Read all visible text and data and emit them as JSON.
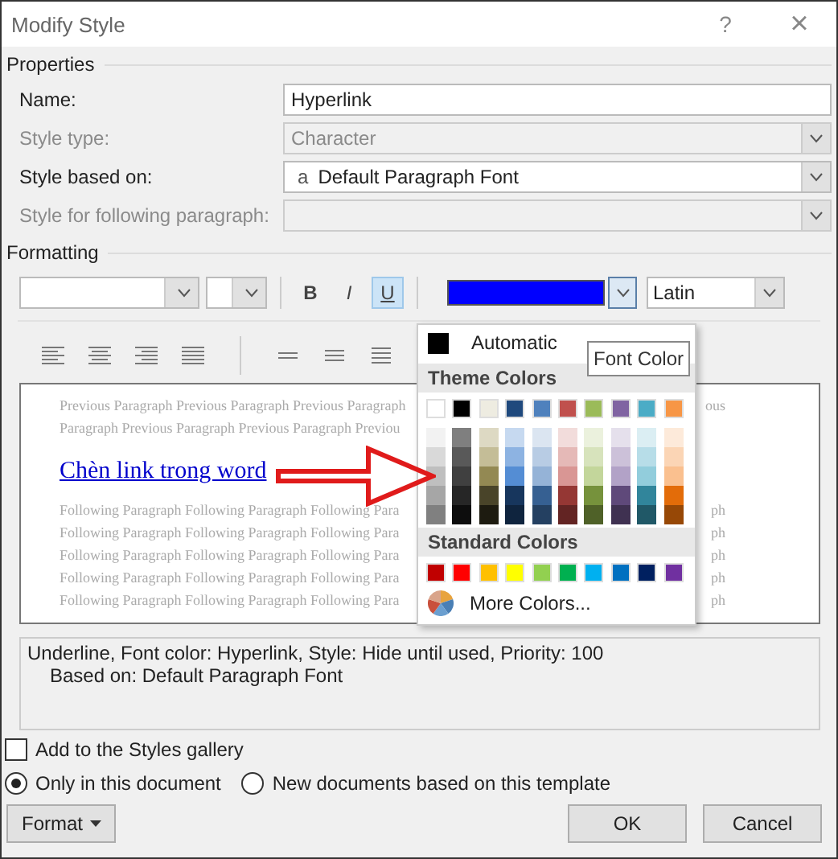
{
  "window": {
    "title": "Modify Style",
    "help": "?",
    "close": "×"
  },
  "properties": {
    "heading": "Properties",
    "fields": [
      {
        "label": "Name:",
        "value": "Hyperlink",
        "kind": "text",
        "disabled": false
      },
      {
        "label": "Style type:",
        "value": "Character",
        "kind": "dropdown",
        "disabled": true
      },
      {
        "label": "Style based on:",
        "value": "Default Paragraph Font",
        "glyph": "a",
        "kind": "dropdown",
        "disabled": false
      },
      {
        "label": "Style for following paragraph:",
        "kind": "dropdown",
        "disabled": true
      }
    ]
  },
  "formatting": {
    "heading": "Formatting",
    "styles": [
      {
        "label": "B",
        "selected": false
      },
      {
        "label": "I",
        "selected": false
      },
      {
        "label": "U",
        "selected": true
      }
    ],
    "font_color": {
      "color": "#0000ff"
    },
    "script": {
      "value": "Latin"
    }
  },
  "preview": {
    "previous": [
      {
        "left": "Previous Paragraph Previous Paragraph Previous Paragraph",
        "right": "ous"
      },
      {
        "left": "Paragraph Previous Paragraph Previous Paragraph Previou"
      }
    ],
    "sample": "Chèn link trong word",
    "following": [
      {
        "left": "Following Paragraph Following Paragraph Following Para",
        "right": "ph"
      },
      {
        "left": "Following Paragraph Following Paragraph Following Para",
        "right": "ph"
      },
      {
        "left": "Following Paragraph Following Paragraph Following Para",
        "right": "ph"
      },
      {
        "left": "Following Paragraph Following Paragraph Following Para",
        "right": "ph"
      },
      {
        "left": "Following Paragraph Following Paragraph Following Para",
        "right": "ph"
      }
    ]
  },
  "color_menu": {
    "automatic": "Automatic",
    "tooltip": "Font Color",
    "theme_heading": "Theme Colors",
    "theme": [
      {
        "color": "#ffffff"
      },
      {
        "color": "#000000"
      },
      {
        "color": "#eeece1"
      },
      {
        "color": "#1f497d"
      },
      {
        "color": "#4f81bd"
      },
      {
        "color": "#c0504d"
      },
      {
        "color": "#9bbb59"
      },
      {
        "color": "#8064a2"
      },
      {
        "color": "#4bacc6"
      },
      {
        "color": "#f79646"
      }
    ],
    "shades": [
      [
        {
          "color": "#f2f2f2"
        },
        {
          "color": "#d9d9d9"
        },
        {
          "color": "#bfbfbf"
        },
        {
          "color": "#a6a6a6"
        },
        {
          "color": "#808080"
        }
      ],
      [
        {
          "color": "#7f7f7f"
        },
        {
          "color": "#595959"
        },
        {
          "color": "#404040"
        },
        {
          "color": "#262626"
        },
        {
          "color": "#0d0d0d"
        }
      ],
      [
        {
          "color": "#ddd9c3"
        },
        {
          "color": "#c4bd97"
        },
        {
          "color": "#938953"
        },
        {
          "color": "#494429"
        },
        {
          "color": "#1d1b10"
        }
      ],
      [
        {
          "color": "#c6d9f0"
        },
        {
          "color": "#8db3e2"
        },
        {
          "color": "#548dd4"
        },
        {
          "color": "#17365d"
        },
        {
          "color": "#0f243e"
        }
      ],
      [
        {
          "color": "#dbe5f1"
        },
        {
          "color": "#b8cce4"
        },
        {
          "color": "#95b3d7"
        },
        {
          "color": "#366092"
        },
        {
          "color": "#244061"
        }
      ],
      [
        {
          "color": "#f2dcdb"
        },
        {
          "color": "#e5b9b7"
        },
        {
          "color": "#d99694"
        },
        {
          "color": "#953734"
        },
        {
          "color": "#632423"
        }
      ],
      [
        {
          "color": "#ebf1dd"
        },
        {
          "color": "#d7e3bc"
        },
        {
          "color": "#c3d69b"
        },
        {
          "color": "#76923c"
        },
        {
          "color": "#4f6128"
        }
      ],
      [
        {
          "color": "#e5e0ec"
        },
        {
          "color": "#ccc1d9"
        },
        {
          "color": "#b2a2c7"
        },
        {
          "color": "#5f497a"
        },
        {
          "color": "#3f3151"
        }
      ],
      [
        {
          "color": "#dbeef3"
        },
        {
          "color": "#b7dde8"
        },
        {
          "color": "#92cddc"
        },
        {
          "color": "#31859b"
        },
        {
          "color": "#205867"
        }
      ],
      [
        {
          "color": "#fdeada"
        },
        {
          "color": "#fbd5b5"
        },
        {
          "color": "#fac08f"
        },
        {
          "color": "#e36c09"
        },
        {
          "color": "#974806"
        }
      ]
    ],
    "standard_heading": "Standard Colors",
    "standard": [
      {
        "color": "#c00000"
      },
      {
        "color": "#ff0000"
      },
      {
        "color": "#ffc000"
      },
      {
        "color": "#ffff00"
      },
      {
        "color": "#92d050"
      },
      {
        "color": "#00b050"
      },
      {
        "color": "#00b0f0"
      },
      {
        "color": "#0070c0"
      },
      {
        "color": "#002060"
      },
      {
        "color": "#7030a0"
      }
    ],
    "more": "More Colors..."
  },
  "description": [
    "Underline, Font color: Hyperlink, Style: Hide until used, Priority: 100",
    "Based on: Default Paragraph Font"
  ],
  "gallery": {
    "label": "Add to the Styles gallery",
    "checked": false
  },
  "scope": [
    {
      "label": "Only in this document",
      "selected": true
    },
    {
      "label": "New documents based on this template",
      "selected": false
    }
  ],
  "buttons": {
    "format": "Format",
    "ok": "OK",
    "cancel": "Cancel"
  }
}
